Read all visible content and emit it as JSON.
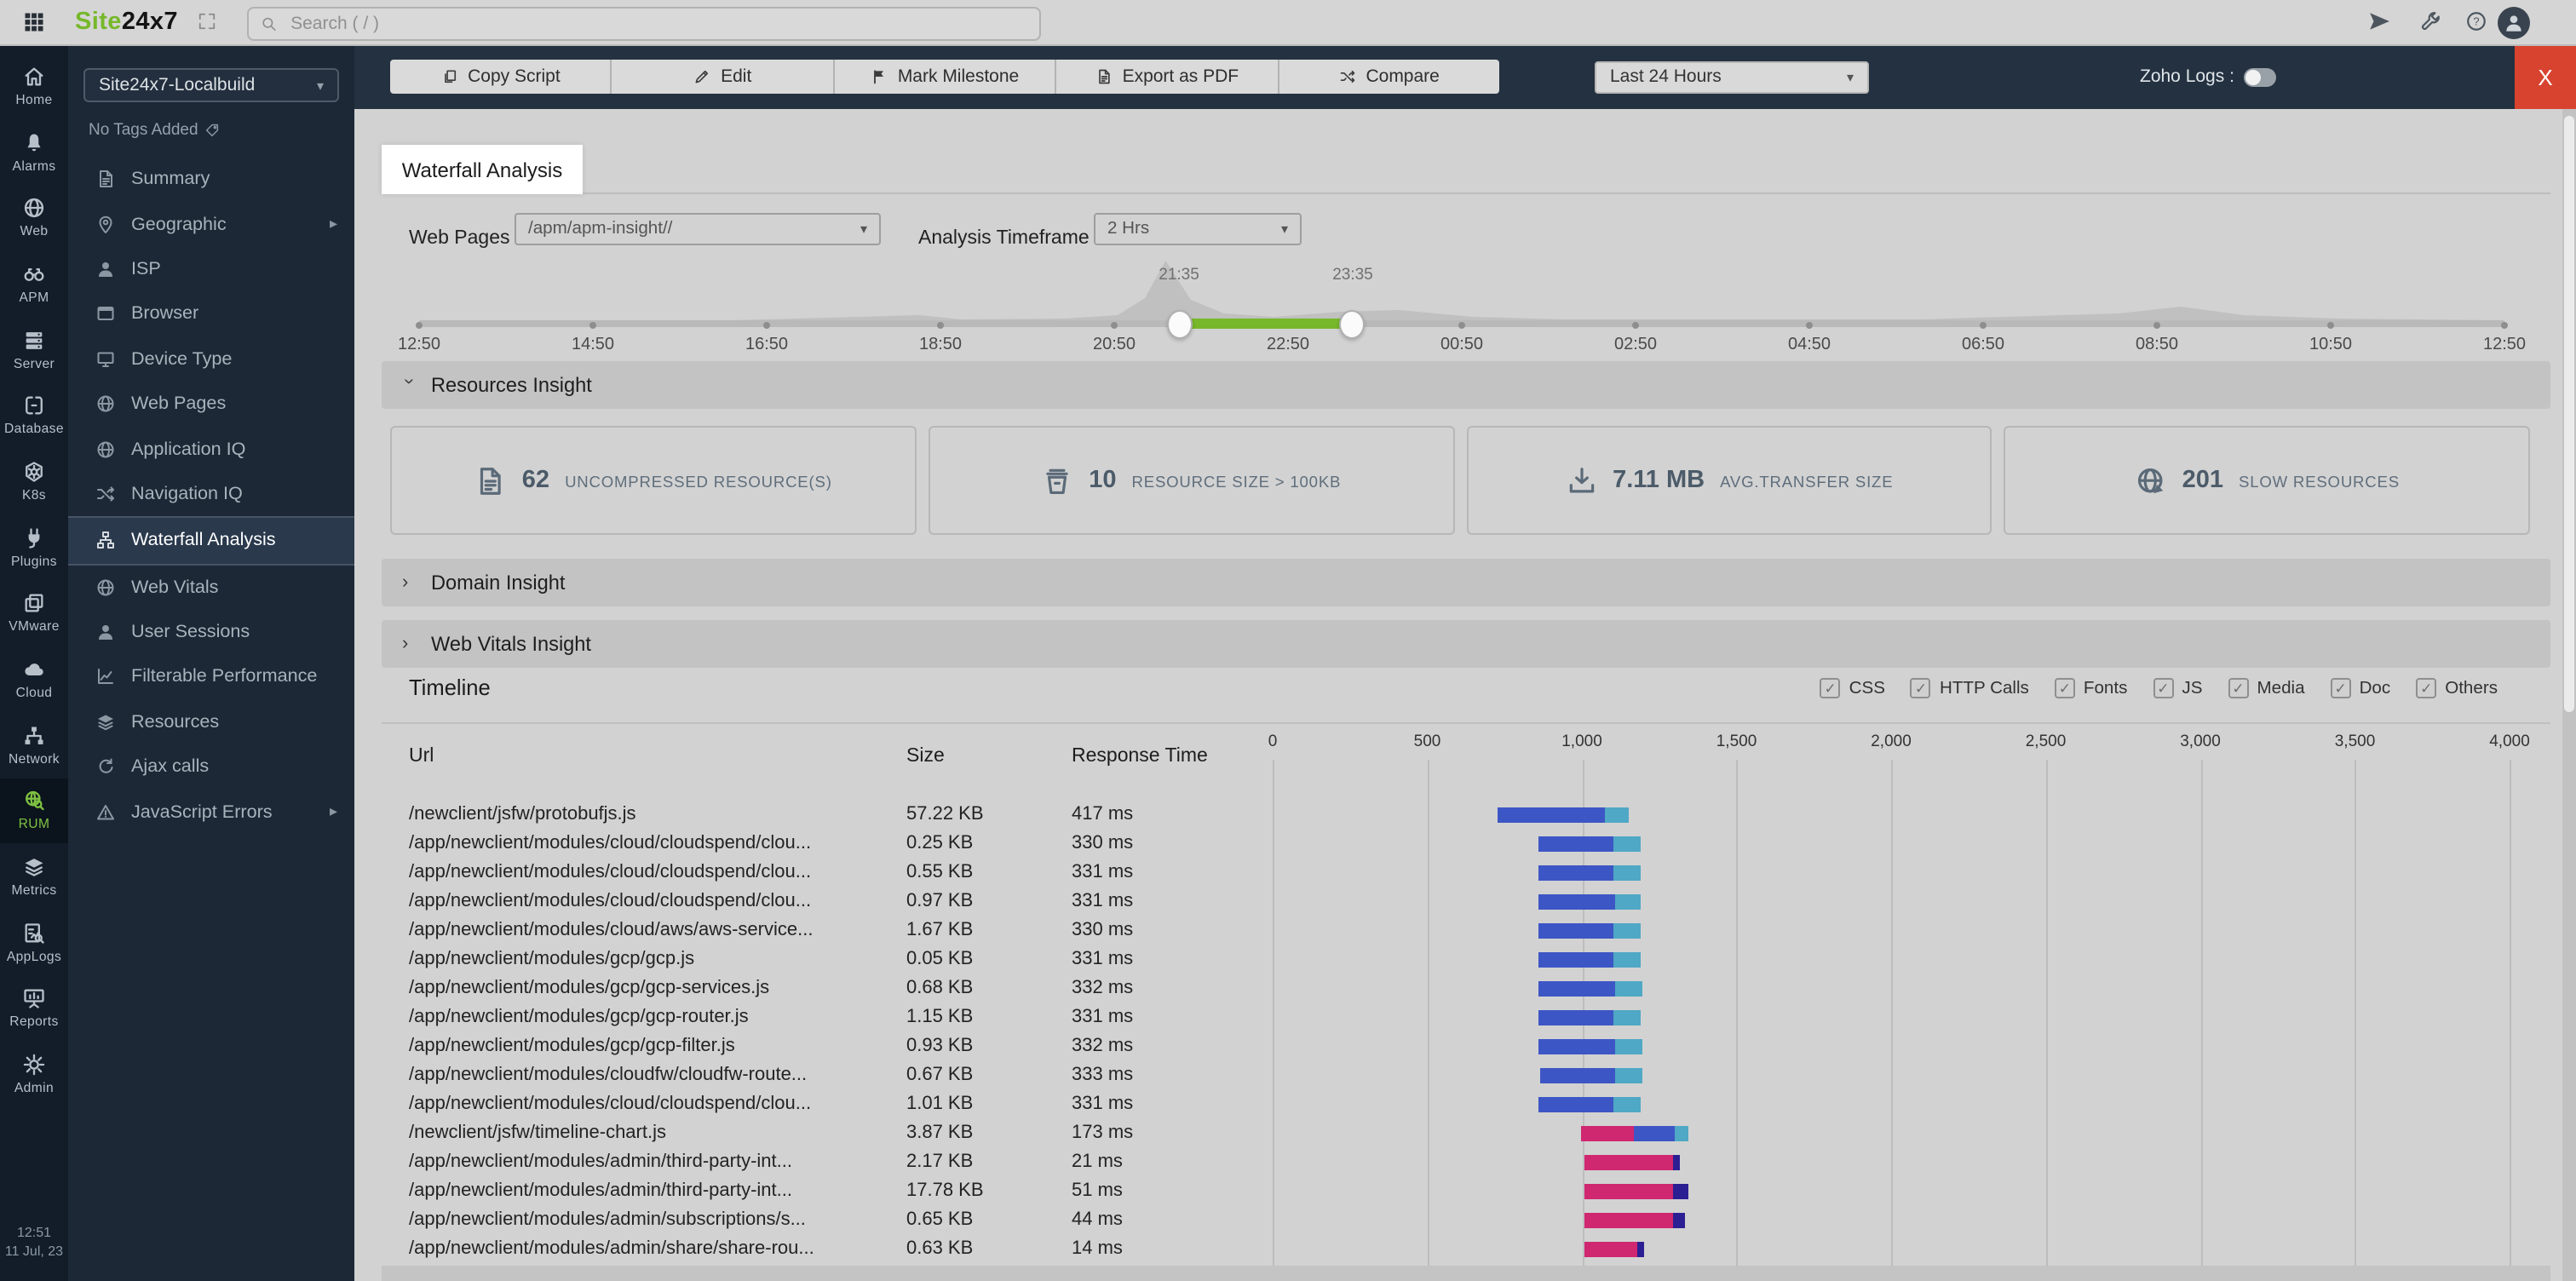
{
  "topbar": {
    "logo_part1": "Site",
    "logo_part2": "24x7",
    "search_placeholder": "Search ( / )"
  },
  "rail": {
    "items": [
      {
        "label": "Home",
        "icon": "home",
        "active": false
      },
      {
        "label": "Alarms",
        "icon": "bell",
        "active": false
      },
      {
        "label": "Web",
        "icon": "globe",
        "active": false
      },
      {
        "label": "APM",
        "icon": "binoculars",
        "active": false
      },
      {
        "label": "Server",
        "icon": "server",
        "active": false
      },
      {
        "label": "Database",
        "icon": "database",
        "active": false
      },
      {
        "label": "K8s",
        "icon": "k8s",
        "active": false
      },
      {
        "label": "Plugins",
        "icon": "plug",
        "active": false
      },
      {
        "label": "VMware",
        "icon": "vmware",
        "active": false
      },
      {
        "label": "Cloud",
        "icon": "cloud",
        "active": false
      },
      {
        "label": "Network",
        "icon": "network",
        "active": false
      },
      {
        "label": "RUM",
        "icon": "rum",
        "active": true
      },
      {
        "label": "Metrics",
        "icon": "layers",
        "active": false
      },
      {
        "label": "AppLogs",
        "icon": "applogs",
        "active": false
      },
      {
        "label": "Reports",
        "icon": "reports",
        "active": false
      },
      {
        "label": "Admin",
        "icon": "gear",
        "active": false
      }
    ],
    "clock_time": "12:51",
    "clock_date": "11 Jul, 23"
  },
  "sidebar": {
    "monitor_name": "Site24x7-Localbuild",
    "tags_text": "No Tags Added",
    "items": [
      {
        "label": "Summary",
        "icon": "docfile",
        "arrow": false,
        "active": false
      },
      {
        "label": "Geographic",
        "icon": "pin",
        "arrow": true,
        "active": false
      },
      {
        "label": "ISP",
        "icon": "person",
        "arrow": false,
        "active": false
      },
      {
        "label": "Browser",
        "icon": "browser",
        "arrow": false,
        "active": false
      },
      {
        "label": "Device Type",
        "icon": "monitor",
        "arrow": false,
        "active": false
      },
      {
        "label": "Web Pages",
        "icon": "globe",
        "arrow": false,
        "active": false
      },
      {
        "label": "Application IQ",
        "icon": "globe",
        "arrow": false,
        "active": false
      },
      {
        "label": "Navigation IQ",
        "icon": "shuffle",
        "arrow": false,
        "active": false
      },
      {
        "label": "Waterfall Analysis",
        "icon": "sitemap",
        "arrow": false,
        "active": true
      },
      {
        "label": "Web Vitals",
        "icon": "globe",
        "arrow": false,
        "active": false
      },
      {
        "label": "User Sessions",
        "icon": "person",
        "arrow": false,
        "active": false
      },
      {
        "label": "Filterable Performance",
        "icon": "chartline",
        "arrow": false,
        "active": false
      },
      {
        "label": "Resources",
        "icon": "layers",
        "arrow": false,
        "active": false
      },
      {
        "label": "Ajax calls",
        "icon": "refresh",
        "arrow": false,
        "active": false
      },
      {
        "label": "JavaScript Errors",
        "icon": "warning",
        "arrow": true,
        "active": false
      }
    ]
  },
  "toolbar": {
    "buttons": [
      {
        "label": "Copy Script",
        "icon": "copy"
      },
      {
        "label": "Edit",
        "icon": "pencil"
      },
      {
        "label": "Mark Milestone",
        "icon": "flag"
      },
      {
        "label": "Export as PDF",
        "icon": "docfile"
      },
      {
        "label": "Compare",
        "icon": "shuffle"
      }
    ],
    "time_range_value": "Last 24 Hours",
    "zoho_logs_label": "Zoho Logs :",
    "close_label": "X"
  },
  "page": {
    "tab_title": "Waterfall Analysis"
  },
  "filters": {
    "web_pages_label": "Web Pages",
    "web_pages_value": "/apm/apm-insight//",
    "timeframe_label": "Analysis Timeframe",
    "timeframe_value": "2 Hrs"
  },
  "slider": {
    "tick_labels": [
      "12:50",
      "14:50",
      "16:50",
      "18:50",
      "20:50",
      "22:50",
      "00:50",
      "02:50",
      "04:50",
      "06:50",
      "08:50",
      "10:50",
      "12:50"
    ],
    "selection": {
      "start_label": "21:35",
      "end_label": "23:35",
      "start_frac": 0.3644,
      "end_frac": 0.4477
    },
    "sparkline_points": [
      [
        0,
        1
      ],
      [
        0.15,
        1
      ],
      [
        0.24,
        4
      ],
      [
        0.26,
        1.5
      ],
      [
        0.31,
        2
      ],
      [
        0.335,
        4
      ],
      [
        0.348,
        14
      ],
      [
        0.358,
        36
      ],
      [
        0.37,
        13
      ],
      [
        0.386,
        5
      ],
      [
        0.41,
        3
      ],
      [
        0.442,
        6
      ],
      [
        0.47,
        7
      ],
      [
        0.505,
        3
      ],
      [
        0.55,
        1.5
      ],
      [
        0.72,
        1.5
      ],
      [
        0.815,
        5
      ],
      [
        0.845,
        9
      ],
      [
        0.875,
        4
      ],
      [
        0.92,
        2
      ],
      [
        1,
        1
      ]
    ]
  },
  "insights": {
    "resources_title": "Resources Insight",
    "domain_title": "Domain Insight",
    "webvitals_title": "Web Vitals Insight",
    "cards": [
      {
        "icon": "docfile",
        "value": "62",
        "label": "UNCOMPRESSED RESOURCE(S)"
      },
      {
        "icon": "bin",
        "value": "10",
        "label": "RESOURCE SIZE > 100KB"
      },
      {
        "icon": "download",
        "value": "7.11 MB",
        "label": "AVG.TRANSFER SIZE"
      },
      {
        "icon": "globearrow",
        "value": "201",
        "label": "SLOW RESOURCES"
      }
    ]
  },
  "timeline": {
    "title": "Timeline",
    "type_filters": [
      {
        "label": "CSS",
        "checked": true
      },
      {
        "label": "HTTP Calls",
        "checked": true
      },
      {
        "label": "Fonts",
        "checked": true
      },
      {
        "label": "JS",
        "checked": true
      },
      {
        "label": "Media",
        "checked": true
      },
      {
        "label": "Doc",
        "checked": true
      },
      {
        "label": "Others",
        "checked": true
      }
    ],
    "columns": [
      "Url",
      "Size",
      "Response Time"
    ],
    "axis": {
      "tick_values": [
        0,
        500,
        1000,
        1500,
        2000,
        2500,
        3000,
        3500,
        4000
      ],
      "tick_labels": [
        "0",
        "500",
        "1,000",
        "1,500",
        "2,000",
        "2,500",
        "3,000",
        "3,500",
        "4,000"
      ],
      "max": 4000
    },
    "rows": [
      {
        "url": "/newclient/jsfw/protobufjs.js",
        "size": "57.22 KB",
        "time": "417 ms",
        "bar": {
          "start": 730,
          "segments": [
            {
              "color": "blue",
              "end": 1075
            },
            {
              "color": "cyan",
              "end": 1150
            }
          ]
        }
      },
      {
        "url": "/app/newclient/modules/cloud/cloudspend/clou...",
        "size": "0.25 KB",
        "time": "330 ms",
        "bar": {
          "start": 858,
          "segments": [
            {
              "color": "blue",
              "end": 1102
            },
            {
              "color": "cyan",
              "end": 1188
            }
          ]
        }
      },
      {
        "url": "/app/newclient/modules/cloud/cloudspend/clou...",
        "size": "0.55 KB",
        "time": "331 ms",
        "bar": {
          "start": 860,
          "segments": [
            {
              "color": "blue",
              "end": 1104
            },
            {
              "color": "cyan",
              "end": 1191
            }
          ]
        }
      },
      {
        "url": "/app/newclient/modules/cloud/cloudspend/clou...",
        "size": "0.97 KB",
        "time": "331 ms",
        "bar": {
          "start": 860,
          "segments": [
            {
              "color": "blue",
              "end": 1105
            },
            {
              "color": "cyan",
              "end": 1191
            }
          ]
        }
      },
      {
        "url": "/app/newclient/modules/cloud/aws/aws-service...",
        "size": "1.67 KB",
        "time": "330 ms",
        "bar": {
          "start": 858,
          "segments": [
            {
              "color": "blue",
              "end": 1102
            },
            {
              "color": "cyan",
              "end": 1188
            }
          ]
        }
      },
      {
        "url": "/app/newclient/modules/gcp/gcp.js",
        "size": "0.05 KB",
        "time": "331 ms",
        "bar": {
          "start": 860,
          "segments": [
            {
              "color": "blue",
              "end": 1104
            },
            {
              "color": "cyan",
              "end": 1191
            }
          ]
        }
      },
      {
        "url": "/app/newclient/modules/gcp/gcp-services.js",
        "size": "0.68 KB",
        "time": "332 ms",
        "bar": {
          "start": 862,
          "segments": [
            {
              "color": "blue",
              "end": 1107
            },
            {
              "color": "cyan",
              "end": 1194
            }
          ]
        }
      },
      {
        "url": "/app/newclient/modules/gcp/gcp-router.js",
        "size": "1.15 KB",
        "time": "331 ms",
        "bar": {
          "start": 860,
          "segments": [
            {
              "color": "blue",
              "end": 1104
            },
            {
              "color": "cyan",
              "end": 1191
            }
          ]
        }
      },
      {
        "url": "/app/newclient/modules/gcp/gcp-filter.js",
        "size": "0.93 KB",
        "time": "332 ms",
        "bar": {
          "start": 862,
          "segments": [
            {
              "color": "blue",
              "end": 1107
            },
            {
              "color": "cyan",
              "end": 1194
            }
          ]
        }
      },
      {
        "url": "/app/newclient/modules/cloudfw/cloudfw-route...",
        "size": "0.67 KB",
        "time": "333 ms",
        "bar": {
          "start": 864,
          "segments": [
            {
              "color": "blue",
              "end": 1110
            },
            {
              "color": "cyan",
              "end": 1197
            }
          ]
        }
      },
      {
        "url": "/app/newclient/modules/cloud/cloudspend/clou...",
        "size": "1.01 KB",
        "time": "331 ms",
        "bar": {
          "start": 860,
          "segments": [
            {
              "color": "blue",
              "end": 1104
            },
            {
              "color": "cyan",
              "end": 1191
            }
          ]
        }
      },
      {
        "url": "/newclient/jsfw/timeline-chart.js",
        "size": "3.87 KB",
        "time": "173 ms",
        "bar": {
          "start": 995,
          "segments": [
            {
              "color": "pink",
              "end": 1170
            },
            {
              "color": "blue",
              "end": 1300
            },
            {
              "color": "cyan",
              "end": 1345
            }
          ]
        }
      },
      {
        "url": "/app/newclient/modules/admin/third-party-int...",
        "size": "2.17 KB",
        "time": "21 ms",
        "bar": {
          "start": 1010,
          "segments": [
            {
              "color": "pink",
              "end": 1295
            },
            {
              "color": "navy",
              "end": 1315
            }
          ]
        }
      },
      {
        "url": "/app/newclient/modules/admin/third-party-int...",
        "size": "17.78 KB",
        "time": "51 ms",
        "bar": {
          "start": 1010,
          "segments": [
            {
              "color": "pink",
              "end": 1295
            },
            {
              "color": "navy",
              "end": 1345
            }
          ]
        }
      },
      {
        "url": "/app/newclient/modules/admin/subscriptions/s...",
        "size": "0.65 KB",
        "time": "44 ms",
        "bar": {
          "start": 1010,
          "segments": [
            {
              "color": "pink",
              "end": 1295
            },
            {
              "color": "navy",
              "end": 1335
            }
          ]
        }
      },
      {
        "url": "/app/newclient/modules/admin/share/share-rou...",
        "size": "0.63 KB",
        "time": "14 ms",
        "bar": {
          "start": 1010,
          "segments": [
            {
              "color": "pink",
              "end": 1180
            },
            {
              "color": "navy",
              "end": 1200
            }
          ]
        }
      }
    ]
  },
  "colors": {
    "accent_green": "#76b82a",
    "bar_blue": "#3d56c5",
    "bar_cyan": "#4fa8c5",
    "bar_pink": "#cf2770",
    "bar_navy": "#2c1f93",
    "close_red": "#d8432f"
  }
}
